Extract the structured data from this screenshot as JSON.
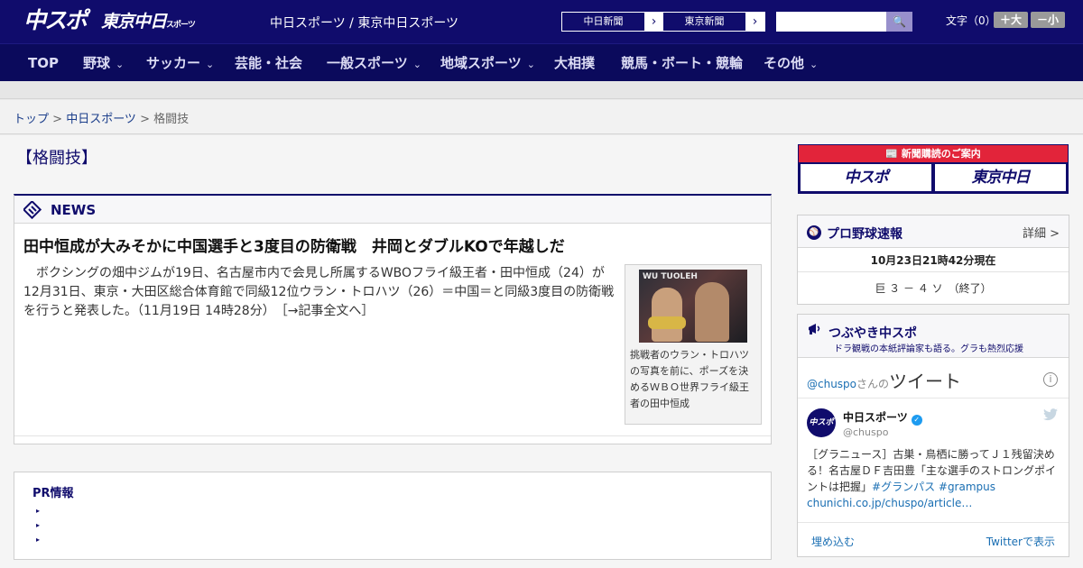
{
  "header": {
    "logo_chuspo": "中スポ",
    "logo_tokyo": "東京中日",
    "logo_tokyo_small": "スポーツ",
    "site_links": "中日スポーツ / 東京中日スポーツ",
    "pill_chunichi": "中日新聞",
    "pill_tokyo": "東京新聞",
    "pill_arrow": "›",
    "search_placeholder": "",
    "search_icon": "🔍",
    "fontsize_label": "文字（0）",
    "font_larger": "＋大",
    "font_smaller": "－小"
  },
  "nav": {
    "items": [
      {
        "label": "TOP"
      },
      {
        "label": "野球"
      },
      {
        "label": "サッカー"
      },
      {
        "label": "芸能・社会"
      },
      {
        "label": "一般スポーツ"
      },
      {
        "label": "地域スポーツ"
      },
      {
        "label": "大相撲"
      },
      {
        "label": "競馬・ボート・競輪"
      },
      {
        "label": "その他"
      }
    ],
    "chev": "⌄"
  },
  "breadcrumb": {
    "top": "トップ",
    "sep1": " > ",
    "chunichi": "中日スポーツ",
    "sep2": " > ",
    "current": "格闘技"
  },
  "page_title": "【格闘技】",
  "news": {
    "label": "NEWS",
    "headline": "田中恒成が大みそかに中国選手と3度目の防衛戦　井岡とダブルKOで年越しだ",
    "body": "ボクシングの畑中ジムが19日、名古屋市内で会見し所属するWBOフライ級王者・田中恒成（24）が12月31日、東京・大田区総合体育館で同級12位ウラン・トロハツ（26）＝中国＝と同級3度目の防衛戦を行うと発表した。（11月19日 14時28分）　［→記事全文へ］",
    "photo_text": "WU  TUOLEH",
    "caption": "挑戦者のウラン・トロハツの写真を前に、ポーズを決めるＷＢＯ世界フライ級王者の田中恒成"
  },
  "pr": {
    "title": "PR情報",
    "bullets": [
      "▸",
      "▸",
      "▸"
    ]
  },
  "sidebar": {
    "subscribe_title": "📰 新聞購読のご案内",
    "subscribe_chuspo": "中スポ",
    "subscribe_tokyo": "東京中日",
    "score": {
      "title": "プロ野球速報",
      "more": "詳細 >",
      "time": "10月23日21時42分現在",
      "row": "巨 ３ － ４ ソ　（終了）"
    },
    "tweets": {
      "title": "つぶやき中スポ",
      "sub": "ドラ観戦の本紙評論家も語る。グラも熱烈応援",
      "handle": "@chuspo",
      "handle_suffix": "さんの",
      "tweet_word": "ツイート",
      "info": "i",
      "name": "中日スポーツ",
      "verified": "✓",
      "screen_name": "@chuspo",
      "avatar_text": "中スポ",
      "text": "［グラニュース］古巣・鳥栖に勝ってＪ１残留決める！名古屋ＤＦ吉田豊「主な選手のストロングポイントは把握」",
      "hashtags": "#グランパス #grampus",
      "link": "chunichi.co.jp/chuspo/article…",
      "embed": "埋め込む",
      "view": "Twitterで表示"
    }
  }
}
